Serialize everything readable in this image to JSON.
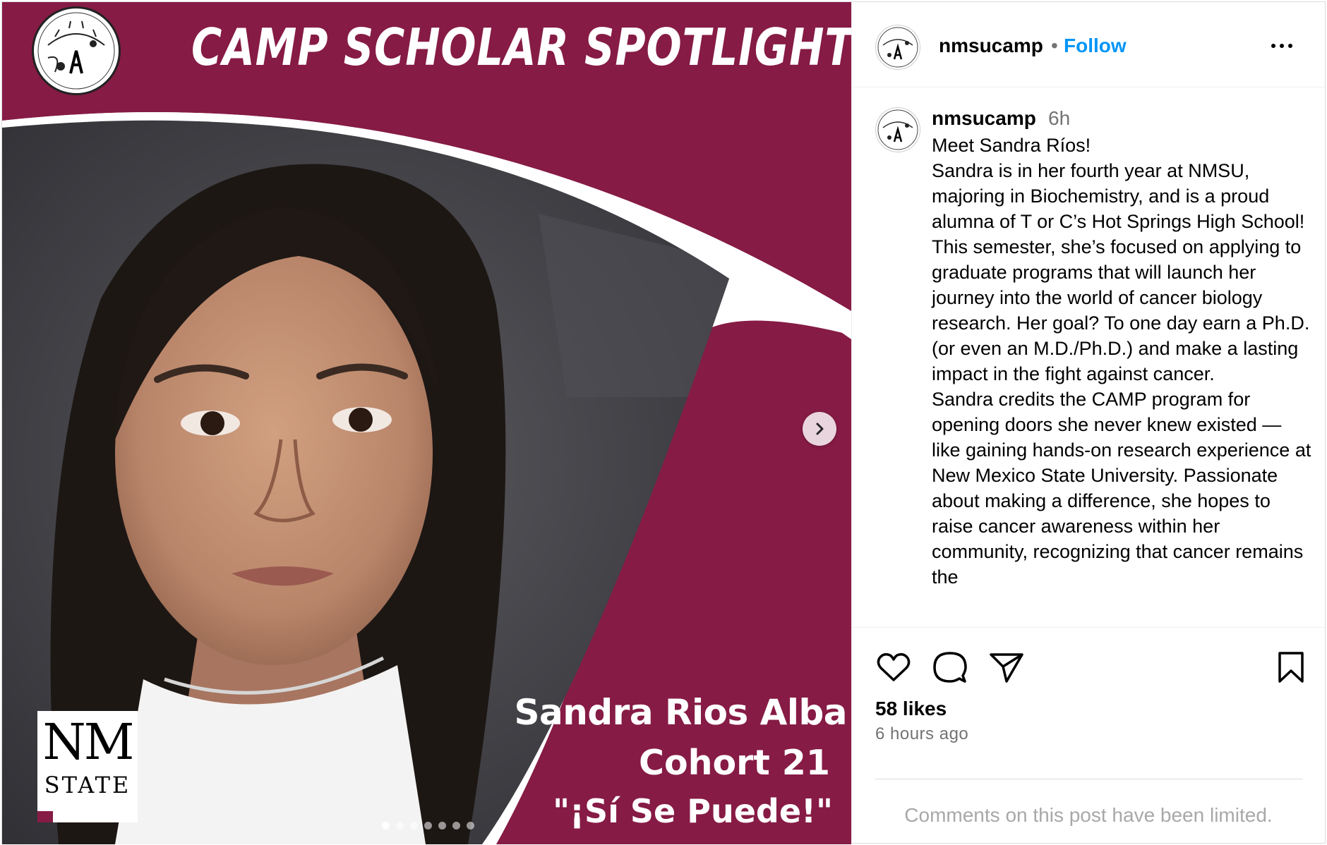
{
  "media": {
    "title": "CAMP SCHOLAR SPOTLIGHT",
    "scholar_name": "Sandra Rios Alba",
    "cohort": "Cohort 21",
    "motto": "\"¡Sí Se Puede!\"",
    "nm_logo_line1": "NM",
    "nm_logo_line2": "STATE",
    "brand_logo": "nmsu-camp-logo",
    "background_color": "#861b45",
    "carousel": {
      "total": 7,
      "active_index": 0,
      "next_icon": "chevron-right-icon"
    }
  },
  "header": {
    "username": "nmsucamp",
    "separator": "•",
    "follow_label": "Follow",
    "more_icon": "more-horizontal-icon"
  },
  "caption": {
    "username": "nmsucamp",
    "time": "6h",
    "paragraphs": [
      "Meet Sandra Ríos!",
      "Sandra is in her fourth year at NMSU, majoring in Biochemistry, and is a proud alumna of T or C’s Hot Springs High School!",
      "This semester, she’s focused on applying to graduate programs that will launch her journey into the world of cancer biology research. Her goal? To one day earn a Ph.D. (or even an M.D./Ph.D.) and make a lasting impact in the fight against cancer.",
      "Sandra credits the CAMP program for opening doors she never knew existed — like gaining hands-on research experience at New Mexico State University. Passionate about making a difference, she hopes to raise cancer awareness within her community, recognizing that cancer remains the"
    ]
  },
  "actions": {
    "icons": [
      "heart-icon",
      "comment-icon",
      "share-icon",
      "bookmark-icon"
    ],
    "likes": "58 likes",
    "time_ago": "6 hours ago",
    "comments_notice": "Comments on this post have been limited."
  },
  "colors": {
    "accent": "#0095f6",
    "maroon": "#861b45",
    "muted": "#737373"
  }
}
